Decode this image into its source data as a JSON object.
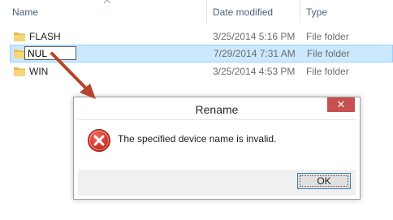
{
  "columns": {
    "name": "Name",
    "date_modified": "Date modified",
    "type": "Type"
  },
  "files": [
    {
      "name": "FLASH",
      "date": "3/25/2014 5:16 PM",
      "type": "File folder"
    },
    {
      "name": "NUL",
      "date": "7/29/2014 7:31 AM",
      "type": "File folder",
      "selected": true,
      "renaming": true
    },
    {
      "name": "WIN",
      "date": "3/25/2014 4:53 PM",
      "type": "File folder"
    }
  ],
  "rename_value": "NUL",
  "dialog": {
    "title": "Rename",
    "close_label": "✕",
    "message": "The specified device name is invalid.",
    "ok_label": "OK"
  },
  "colors": {
    "selection_bg": "#cce8ff",
    "selection_border": "#99d1ff",
    "close_button": "#c75050",
    "error_red": "#d9342b",
    "arrow": "#b8422a"
  },
  "icons": {
    "folder": "folder-icon",
    "sort": "sort-up-icon",
    "error": "error-icon",
    "annotation_arrow": "annotation-arrow"
  }
}
